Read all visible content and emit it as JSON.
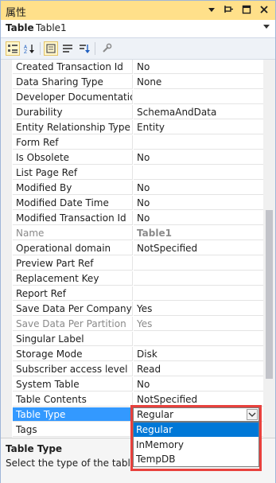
{
  "panel": {
    "title": "属性",
    "icons": [
      "dropdown-arrow-icon",
      "pin-icon",
      "maximize-icon",
      "close-icon"
    ]
  },
  "object": {
    "kind": "Table",
    "name": "Table1"
  },
  "toolbar": {
    "buttons": [
      "categorized-icon",
      "alphabetical-icon",
      "properties-icon",
      "events-icon",
      "sort-icon",
      "wrench-icon"
    ]
  },
  "properties": [
    {
      "name": "Created Transaction Id",
      "value": "No"
    },
    {
      "name": "Data Sharing Type",
      "value": "None"
    },
    {
      "name": "Developer Documentation",
      "value": ""
    },
    {
      "name": "Durability",
      "value": "SchemaAndData"
    },
    {
      "name": "Entity Relationship Type",
      "value": "Entity"
    },
    {
      "name": "Form Ref",
      "value": ""
    },
    {
      "name": "Is Obsolete",
      "value": "No"
    },
    {
      "name": "List Page Ref",
      "value": ""
    },
    {
      "name": "Modified By",
      "value": "No"
    },
    {
      "name": "Modified Date Time",
      "value": "No"
    },
    {
      "name": "Modified Transaction Id",
      "value": "No"
    },
    {
      "name": "Name",
      "value": "Table1"
    },
    {
      "name": "Operational domain",
      "value": "NotSpecified"
    },
    {
      "name": "Preview Part Ref",
      "value": ""
    },
    {
      "name": "Replacement Key",
      "value": ""
    },
    {
      "name": "Report Ref",
      "value": ""
    },
    {
      "name": "Save Data Per Company",
      "value": "Yes"
    },
    {
      "name": "Save Data Per Partition",
      "value": "Yes"
    },
    {
      "name": "Singular Label",
      "value": ""
    },
    {
      "name": "Storage Mode",
      "value": "Disk"
    },
    {
      "name": "Subscriber access level",
      "value": "Read"
    },
    {
      "name": "System Table",
      "value": "No"
    },
    {
      "name": "Table Contents",
      "value": "NotSpecified"
    },
    {
      "name": "Table Type",
      "value": "Regular"
    },
    {
      "name": "Tags",
      "value": ""
    }
  ],
  "dropdown": {
    "selected": "Regular",
    "options": [
      "Regular",
      "InMemory",
      "TempDB"
    ]
  },
  "description": {
    "title": "Table Type",
    "text": "Select the type of the table"
  },
  "colors": {
    "title_bar": "#ffe08a",
    "selection": "#3399ff",
    "highlight_box": "#e8413d",
    "dropdown_selection": "#0078d7"
  }
}
